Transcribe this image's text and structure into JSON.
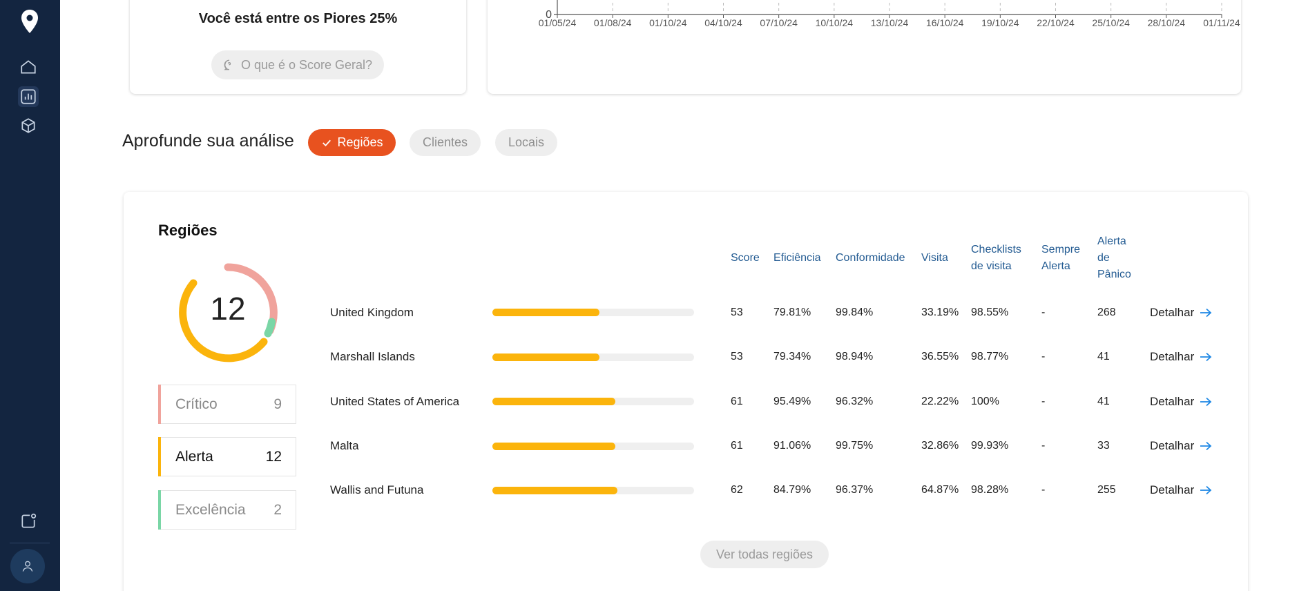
{
  "summary": {
    "worst_text": "Você está entre os Piores 25%",
    "score_help": "O que é o Score Geral?"
  },
  "timeline_chart": {
    "y_tick": "0",
    "x_ticks": [
      "01/05/24",
      "01/08/24",
      "01/10/24",
      "04/10/24",
      "07/10/24",
      "10/10/24",
      "13/10/24",
      "16/10/24",
      "19/10/24",
      "22/10/24",
      "25/10/24",
      "28/10/24",
      "01/11/24"
    ]
  },
  "analysis": {
    "title": "Aprofunde sua análise",
    "tabs": [
      {
        "label": "Regiões",
        "active": true
      },
      {
        "label": "Clientes",
        "active": false
      },
      {
        "label": "Locais",
        "active": false
      }
    ]
  },
  "regions": {
    "title": "Regiões",
    "total": "12",
    "donut": {
      "critico": 9,
      "alerta": 12,
      "excelencia": 2
    },
    "statuses": [
      {
        "label": "Crítico",
        "count": "9",
        "color": "#f0a39c"
      },
      {
        "label": "Alerta",
        "count": "12",
        "color": "#fbb40c"
      },
      {
        "label": "Excelência",
        "count": "2",
        "color": "#7ad6a6"
      }
    ],
    "headers": {
      "score": "Score",
      "eficiencia": "Eficiência",
      "conformidade": "Conformidade",
      "visita": "Visita",
      "checklists_1": "Checklists",
      "checklists_2": "de visita",
      "sempre_1": "Sempre",
      "sempre_2": "Alerta",
      "alerta_1": "Alerta",
      "alerta_2": "de",
      "alerta_3": "Pânico"
    },
    "rows": [
      {
        "name": "United Kingdom",
        "score": "53",
        "eficiencia": "79.81%",
        "conformidade": "99.84%",
        "visita": "33.19%",
        "checklists": "98.55%",
        "sempre": "-",
        "panico": "268",
        "detail": "Detalhar",
        "bar": 0.53
      },
      {
        "name": "Marshall Islands",
        "score": "53",
        "eficiencia": "79.34%",
        "conformidade": "98.94%",
        "visita": "36.55%",
        "checklists": "98.77%",
        "sempre": "-",
        "panico": "41",
        "detail": "Detalhar",
        "bar": 0.53
      },
      {
        "name": "United States of America",
        "score": "61",
        "eficiencia": "95.49%",
        "conformidade": "96.32%",
        "visita": "22.22%",
        "checklists": "100%",
        "sempre": "-",
        "panico": "41",
        "detail": "Detalhar",
        "bar": 0.61
      },
      {
        "name": "Malta",
        "score": "61",
        "eficiencia": "91.06%",
        "conformidade": "99.75%",
        "visita": "32.86%",
        "checklists": "99.93%",
        "sempre": "-",
        "panico": "33",
        "detail": "Detalhar",
        "bar": 0.61
      },
      {
        "name": "Wallis and Futuna",
        "score": "62",
        "eficiencia": "84.79%",
        "conformidade": "96.37%",
        "visita": "64.87%",
        "checklists": "98.28%",
        "sempre": "-",
        "panico": "255",
        "detail": "Detalhar",
        "bar": 0.62
      }
    ],
    "see_all": "Ver todas regiões"
  },
  "colors": {
    "accent": "#e8521f",
    "sidebar": "#132540",
    "bar": "#fbb40c",
    "header_link": "#235b92",
    "arrow": "#1e88e5"
  }
}
